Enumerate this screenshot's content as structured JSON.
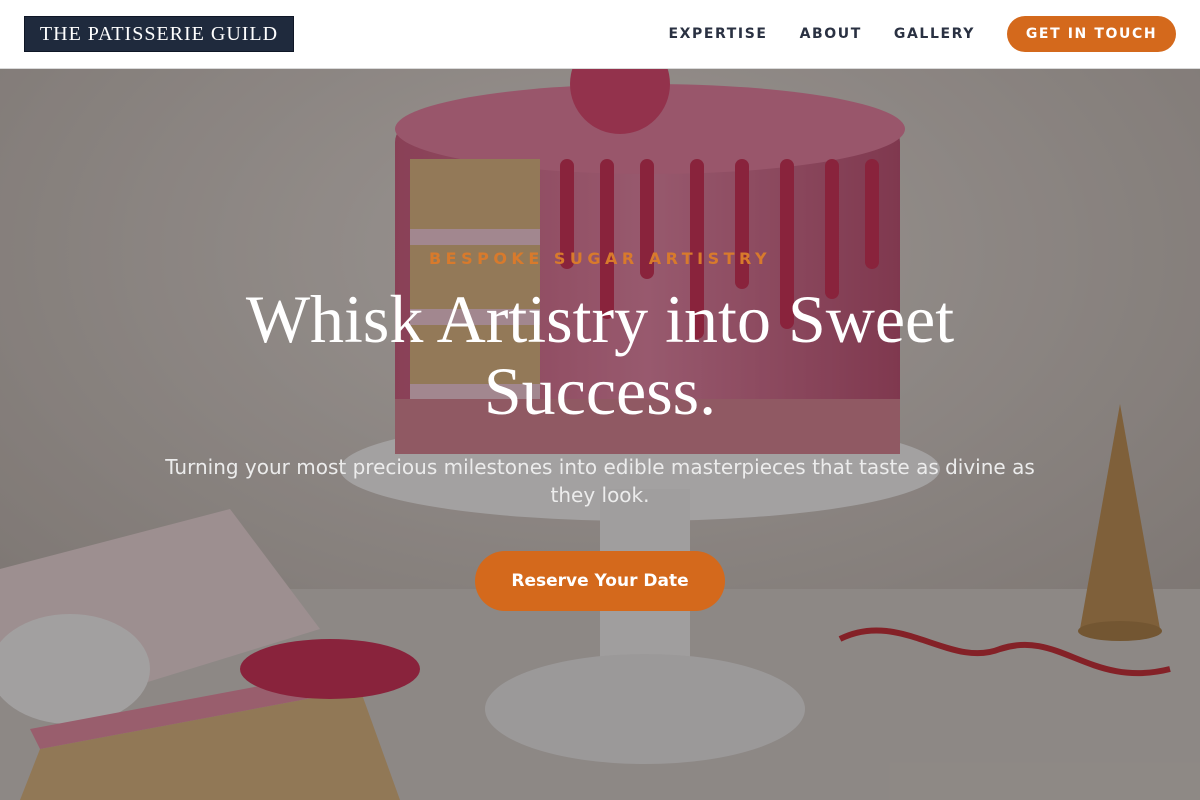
{
  "brand": {
    "name": "THE PATISSERIE GUILD"
  },
  "nav": {
    "links": [
      "EXPERTISE",
      "ABOUT",
      "GALLERY"
    ],
    "cta": "GET IN TOUCH"
  },
  "hero": {
    "eyebrow": "BESPOKE SUGAR ARTISTRY",
    "headline": "Whisk Artistry into Sweet Success.",
    "subline": "Turning your most precious milestones into edible masterpieces that taste as divine as they look.",
    "cta": "Reserve Your Date",
    "image": "pink-drip-cake-photo"
  },
  "colors": {
    "accent": "#d4691c",
    "eyebrow": "#d87a2c",
    "logo_bg": "#1f2a3d",
    "nav_text": "#2a3142"
  }
}
